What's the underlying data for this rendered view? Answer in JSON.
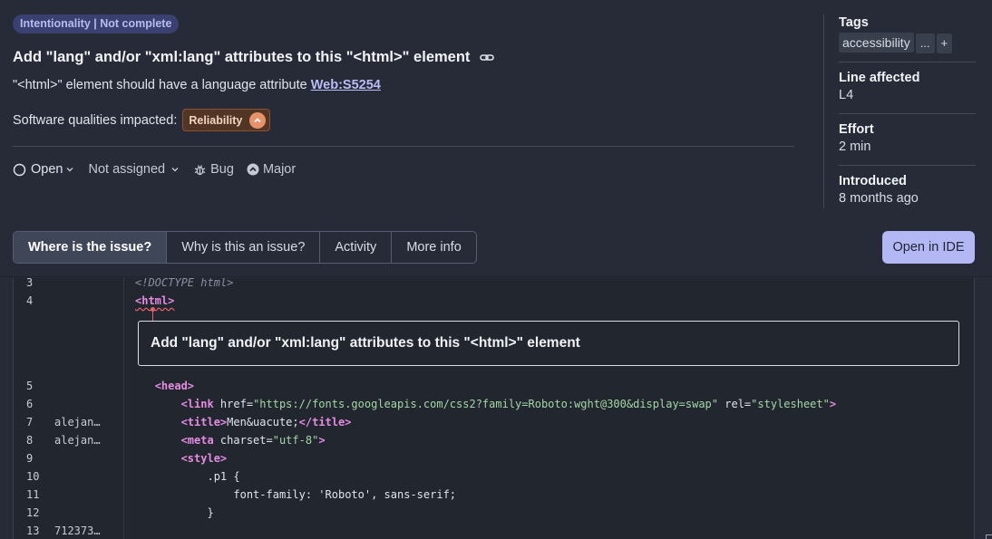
{
  "issue": {
    "badge": "Intentionality | Not complete",
    "title": "Add \"lang\" and/or \"xml:lang\" attributes to this \"<html>\" element",
    "rule_text": "\"<html>\" element should have a language attribute",
    "rule_link": "Web:S5254",
    "qualities_label": "Software qualities impacted:",
    "quality": "Reliability"
  },
  "status": {
    "state": "Open",
    "assignee": "Not assigned",
    "type": "Bug",
    "severity": "Major"
  },
  "sidebar": {
    "tags_label": "Tags",
    "tags": [
      "accessibility"
    ],
    "more_tags": "...",
    "add_tag": "+",
    "line_label": "Line affected",
    "line_value": "L4",
    "effort_label": "Effort",
    "effort_value": "2 min",
    "introduced_label": "Introduced",
    "introduced_value": "8 months ago"
  },
  "tabs": [
    "Where is the issue?",
    "Why is this an issue?",
    "Activity",
    "More info"
  ],
  "active_tab": "Where is the issue?",
  "open_ide_label": "Open in IDE",
  "code": {
    "inline_message": "Add \"lang\" and/or \"xml:lang\" attributes to this \"<html>\" element",
    "lines": [
      {
        "num": "3",
        "author": "",
        "text": "<!DOCTYPE html>"
      },
      {
        "num": "4",
        "author": "",
        "text": "<html>"
      },
      {
        "num": "5",
        "author": "",
        "text": "<head>"
      },
      {
        "num": "6",
        "author": "",
        "text": "<link href=\"https://fonts.googleapis.com/css2?family=Roboto:wght@300&display=swap\" rel=\"stylesheet\">"
      },
      {
        "num": "7",
        "author": "alejan…",
        "text": "<title>Men&uacute;</title>"
      },
      {
        "num": "8",
        "author": "alejan…",
        "text": "<meta charset=\"utf-8\">"
      },
      {
        "num": "9",
        "author": "",
        "text": "<style>"
      },
      {
        "num": "10",
        "author": "",
        "text": ".p1 {"
      },
      {
        "num": "11",
        "author": "",
        "text": "font-family: 'Roboto', sans-serif;"
      },
      {
        "num": "12",
        "author": "",
        "text": "}"
      },
      {
        "num": "13",
        "author": "712373…",
        "text": ""
      }
    ],
    "tokens": {
      "doctype": "<!DOCTYPE html>",
      "html_tag": "<html>",
      "head_tag": "<head>",
      "link_open": "<link",
      "href_attr": " href=",
      "href_val": "\"https://fonts.googleapis.com/css2?family=Roboto:wght@300&display=swap\"",
      "rel_attr": " rel=",
      "rel_val": "\"stylesheet\"",
      "tag_close": ">",
      "title_open": "<title>",
      "title_text": "Men&uacute;",
      "title_close": "</title>",
      "meta_open": "<meta",
      "charset_attr": " charset=",
      "charset_val": "\"utf-8\"",
      "style_tag": "<style>",
      "css_selector": ".p1 {",
      "css_rule": "font-family: 'Roboto', sans-serif;",
      "css_close": "}"
    }
  }
}
